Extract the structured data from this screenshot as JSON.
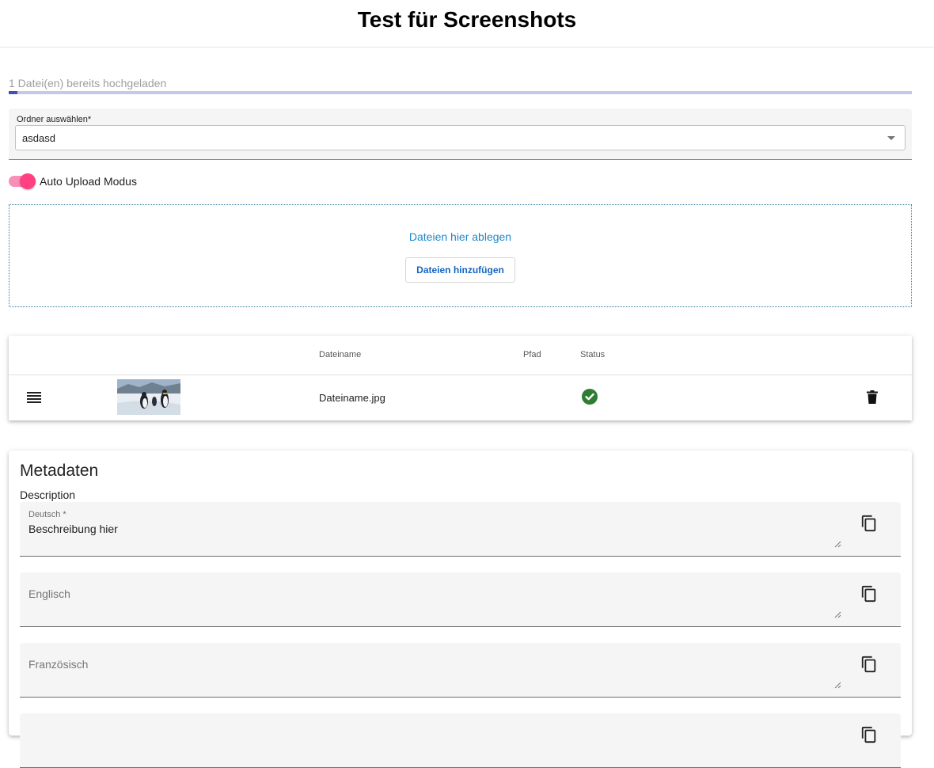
{
  "header": {
    "title": "Test für Screenshots"
  },
  "upload": {
    "status_text": "1 Datei(en) bereits hochgeladen",
    "progress_percent": 1
  },
  "folder_select": {
    "label": "Ordner auswählen*",
    "value": "asdasd"
  },
  "auto_upload": {
    "label": "Auto Upload Modus",
    "checked": true,
    "color": "#ff4081"
  },
  "dropzone": {
    "text": "Dateien hier ablegen",
    "button_label": "Dateien hinzufügen"
  },
  "file_table": {
    "columns": {
      "filename": "Dateiname",
      "path": "Pfad",
      "status": "Status"
    },
    "rows": [
      {
        "filename": "Dateiname.jpg",
        "path": "",
        "status": "ok",
        "status_icon": "check-circle-icon",
        "thumbnail": "penguins-photo"
      }
    ]
  },
  "metadata": {
    "title": "Metadaten",
    "section_label": "Description",
    "fields": [
      {
        "label": "Deutsch *",
        "value": "Beschreibung hier"
      },
      {
        "placeholder": "Englisch"
      },
      {
        "placeholder": "Französisch"
      }
    ]
  },
  "colors": {
    "accent": "#3f51b5",
    "link": "#1e88c9",
    "success": "#2e7d32",
    "toggle": "#ff4081"
  }
}
